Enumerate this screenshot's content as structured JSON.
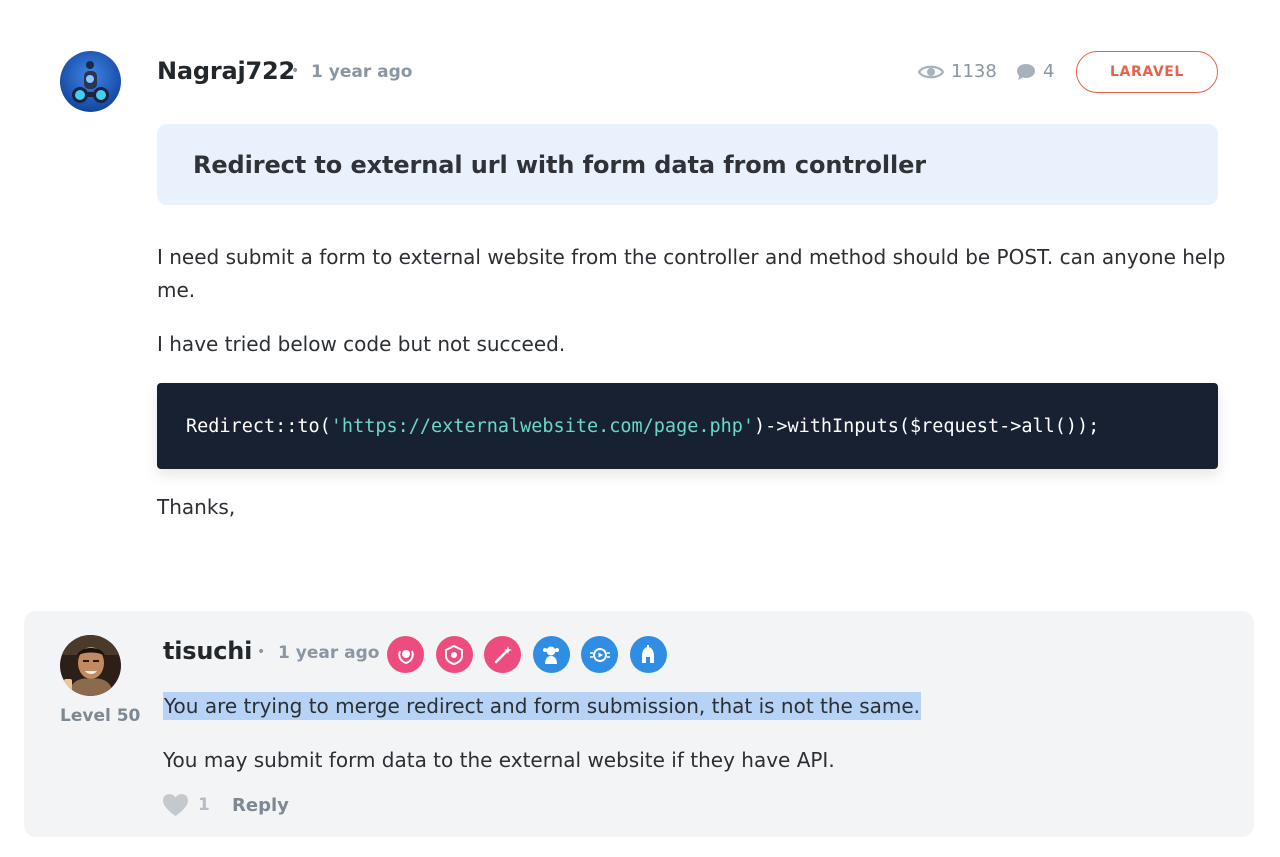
{
  "post": {
    "author": "Nagraj722",
    "separator": "•",
    "time": "1 year ago",
    "views": "1138",
    "replies_count": "4",
    "tag": "LARAVEL",
    "title": "Redirect to external url with form data from controller",
    "body_1": "I need submit a form to external website from the controller and method should be POST. can anyone help me.",
    "body_2": "I have tried below code but not succeed.",
    "code_prefix": "Redirect::to(",
    "code_string": "'https://externalwebsite.com/page.php'",
    "code_suffix": ")->withInputs($request->all());",
    "body_3": "Thanks,"
  },
  "reply": {
    "author": "tisuchi",
    "separator": "•",
    "time": "1 year ago",
    "level": "Level 50",
    "badges": [
      "pink-badge",
      "pink-badge",
      "pink-badge",
      "blue-badge",
      "blue-badge",
      "blue-badge"
    ],
    "text_1": "You are trying to merge redirect and form submission, that is not the same.",
    "text_2": "You may submit form data to the external website if they have API.",
    "likes": "1",
    "reply_label": "Reply"
  },
  "colors": {
    "accent": "#e8624b",
    "title_bg": "#e9f2fc",
    "code_bg": "#172131",
    "code_string": "#6ad8c4",
    "selection": "#b6d3f5",
    "badge_pink": "#ec4d7e",
    "badge_blue": "#2f8ee4"
  }
}
